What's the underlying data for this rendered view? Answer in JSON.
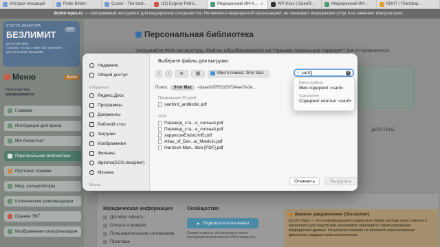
{
  "browser": {
    "tabs": [
      {
        "label": "История операций"
      },
      {
        "label": "Polite Bittern"
      },
      {
        "label": "Cursor - The best..."
      },
      {
        "label": "(11) Evgeny Petro..."
      },
      {
        "label": "Медицинский ИИ-А..."
      },
      {
        "label": "API Keys | OpenR..."
      },
      {
        "label": "Медицинский ИИ-..."
      },
      {
        "label": "КОНТ | Платфор..."
      }
    ],
    "url_host": "doctor-opus.ru",
    "url_text": "— программный инструмент для медицинских специалистов. Не является медицинской организацией, не оказывает медицинских услуг и не заменяет консультацию."
  },
  "sidebar": {
    "subscription_status": "СТАТУС АККАУНТА",
    "plan": "БЕЗЛИМИТ",
    "plan_badge": "VIP",
    "plan_desc_1": "Доступ активен",
    "plan_desc_2": "Спасибо, что вы с нами. Вы получаете",
    "plan_desc_3": "доступ ко всем функциям.",
    "menu_title": "Меню",
    "menu_button": "Выйти",
    "user_label": "Пользователь",
    "user_email": "vasilys@mail.ru",
    "items": [
      {
        "label": "Главная"
      },
      {
        "label": "Инструкция для врача"
      },
      {
        "label": "ИИ-Ассистент"
      },
      {
        "label": "Персональная библиотека"
      },
      {
        "label": "Протокол приёма"
      },
      {
        "label": "Мед. калькуляторы"
      },
      {
        "label": "Клинические рекомендации"
      },
      {
        "label": "Оценка ЭКГ"
      },
      {
        "label": "Изображение+синхронизация"
      }
    ]
  },
  "main": {
    "title": "Персональная библиотека",
    "subtitle": "Загружайте PDF-литературу. Файлы обрабатываются на **вашем локальном сервере** (не отправляются",
    "column_action": "ДЕЙСТВИЕ",
    "legal_title": "Юридическая информация",
    "legal_links": [
      "Договор оферты",
      "Оплата и возврат",
      "Пользовательское соглашение",
      "Политика"
    ],
    "community_title": "Сообщество",
    "subscribe_button": "Подписаться на канал",
    "news_text": "Свежие новости, обновления и новые инструкции использования ИИ в медицине.",
    "disclaimer_title": "Важное уведомление (Disclaimer)",
    "disclaimer_text": "Doctor Opus — это информационно-сервисный сервис на базе искусственного интеллекта для подготовки черновиков описаний и структурирования медицинских данных. Результаты анализа не являются окончательным диагнозом, медицинским заключением"
  },
  "dialog": {
    "title": "Выберите файлы для выгрузки",
    "location_label": "Место поиска: Этот Мас",
    "search_value": "sanf",
    "scope_label": "Поиск:",
    "scope_chip": "Этот Мас",
    "scope_path": "«daae3df7f52b58724aed7e3e...",
    "sidebar": {
      "items_top": [
        {
          "label": "Недавние",
          "icon": "clock-icon"
        },
        {
          "label": "Общий доступ",
          "icon": "shared-icon"
        }
      ],
      "favorites_label": "Избранное",
      "favorites": [
        {
          "label": "Яндекс.Диск",
          "icon": "cloud-icon",
          "color": "#3a7be0"
        },
        {
          "label": "Программы",
          "icon": "apps-icon",
          "color": "#3a7be0"
        },
        {
          "label": "Документы",
          "icon": "doc-icon",
          "color": "#3a7be0"
        },
        {
          "label": "Рабочий стол",
          "icon": "desktop-icon",
          "color": "#3a7be0"
        },
        {
          "label": "Загрузки",
          "icon": "download-icon",
          "color": "#3a7be0"
        },
        {
          "label": "Изображения",
          "icon": "image-icon",
          "color": "#3a7be0"
        },
        {
          "label": "Фильмы",
          "icon": "film-icon",
          "color": "#3a7be0"
        },
        {
          "label": "diploma(ECG-desipher)",
          "icon": "folder-icon",
          "color": "#3a7be0"
        },
        {
          "label": "Музыка",
          "icon": "music-icon",
          "color": "#3a7be0"
        }
      ],
      "places_label": "Места"
    },
    "groups": [
      {
        "label": "Предыдущие 30 дней",
        "files": [
          "sanford_antibiotic.pdf"
        ]
      },
      {
        "label": "2025",
        "files": [
          "Перевод_ста...е_полный.pdf",
          "Перевод_ста...е_полный.pdf",
          "харрисонEndocrinB.pdf",
          "Atlas_of_Der...al_Medicin.pdf",
          "Harrison Man...ition [PDF].pdf"
        ]
      }
    ],
    "suggestions": {
      "names_header": "Имена файлов",
      "names_option": "Имя содержит «sanf»",
      "content_header": "Содержание",
      "content_option": "Содержит контент «sanf»"
    },
    "cancel_label": "Отменить",
    "open_label": "Выгрузить"
  }
}
